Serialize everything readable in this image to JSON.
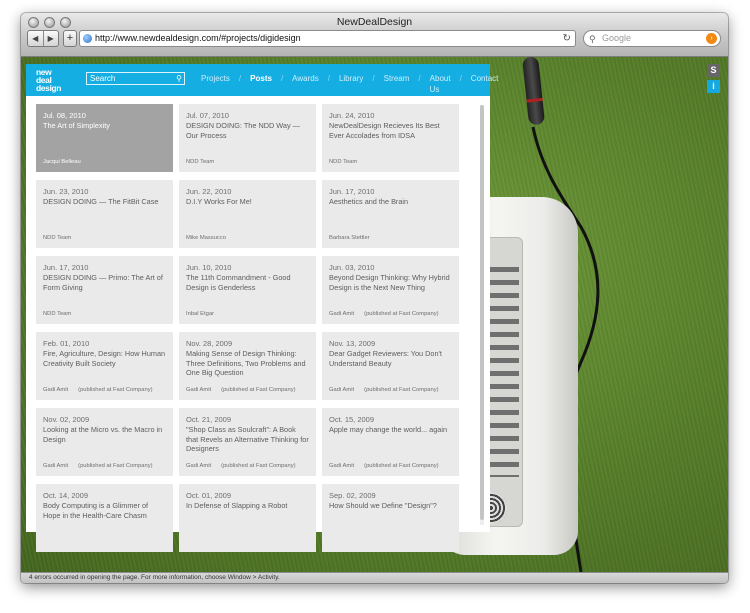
{
  "window": {
    "title": "NewDealDesign"
  },
  "toolbar": {
    "back_label": "◀",
    "forward_label": "▶",
    "add_label": "+",
    "url": "http://www.newdealdesign.com/#projects/digidesign",
    "search_placeholder": "Google"
  },
  "site": {
    "logo": {
      "line1": "new",
      "line2": "deal",
      "line3": "design"
    },
    "search_placeholder": "Search",
    "nav": [
      "Projects",
      "Posts",
      "Awards",
      "Library",
      "Stream",
      "About Us",
      "Contact"
    ],
    "nav_active": "Posts",
    "accent": "#15aee2"
  },
  "badges": {
    "s": "S",
    "i": "i"
  },
  "posts": [
    {
      "date": "Jul. 08, 2010",
      "title": "The Art of Simplexity",
      "author": "Jacqui Belleau",
      "note": ""
    },
    {
      "date": "Jul. 07, 2010",
      "title": "DESIGN DOING: The NDD Way — Our Process",
      "author": "NDD Team",
      "note": ""
    },
    {
      "date": "Jun. 24, 2010",
      "title": "NewDealDesign Recieves Its Best Ever Accolades from IDSA",
      "author": "NDD Team",
      "note": ""
    },
    {
      "date": "Jun. 23, 2010",
      "title": "DESIGN DOING — The FitBit Case",
      "author": "NDD Team",
      "note": ""
    },
    {
      "date": "Jun. 22, 2010",
      "title": "D.I.Y Works For Me!",
      "author": "Mike Massucco",
      "note": ""
    },
    {
      "date": "Jun. 17, 2010",
      "title": "Aesthetics and the Brain",
      "author": "Barbara Stettler",
      "note": ""
    },
    {
      "date": "Jun. 17, 2010",
      "title": "DESIGN DOING — Primo: The Art of Form Giving",
      "author": "NDD Team",
      "note": ""
    },
    {
      "date": "Jun. 10, 2010",
      "title": "The 11th Commandment - Good Design is Genderless",
      "author": "Inbal Etgar",
      "note": ""
    },
    {
      "date": "Jun. 03, 2010",
      "title": "Beyond Design Thinking: Why Hybrid Design is the Next New Thing",
      "author": "Gadi Amit",
      "note": "(published at Fast Company)"
    },
    {
      "date": "Feb. 01, 2010",
      "title": "Fire, Agriculture, Design: How Human Creativity Built Society",
      "author": "Gadi Amit",
      "note": "(published at Fast Company)"
    },
    {
      "date": "Nov. 28, 2009",
      "title": "Making Sense of Design Thinking: Three Definitions, Two Problems and One Big Question",
      "author": "Gadi Amit",
      "note": "(published at Fast Company)"
    },
    {
      "date": "Nov. 13, 2009",
      "title": "Dear Gadget Reviewers: You Don't Understand Beauty",
      "author": "Gadi Amit",
      "note": "(published at Fast Company)"
    },
    {
      "date": "Nov. 02, 2009",
      "title": "Looking at the Micro vs. the Macro in Design",
      "author": "Gadi Amit",
      "note": "(published at Fast Company)"
    },
    {
      "date": "Oct. 21, 2009",
      "title": "\"Shop Class as Soulcraft\": A Book that Revels an Alternative Thinking for Designers",
      "author": "Gadi Amit",
      "note": "(published at Fast Company)"
    },
    {
      "date": "Oct. 15, 2009",
      "title": "Apple may change the world... again",
      "author": "Gadi Amit",
      "note": "(published at Fast Company)"
    },
    {
      "date": "Oct. 14, 2009",
      "title": "Body Computing is a Glimmer of Hope in the Health-Care Chasm",
      "author": "",
      "note": ""
    },
    {
      "date": "Oct. 01, 2009",
      "title": "In Defense of Slapping a Robot",
      "author": "",
      "note": ""
    },
    {
      "date": "Sep. 02, 2009",
      "title": "How Should we Define \"Design\"?",
      "author": "",
      "note": ""
    }
  ],
  "status": "4 errors occurred in opening the page. For more information, choose Window > Activity."
}
